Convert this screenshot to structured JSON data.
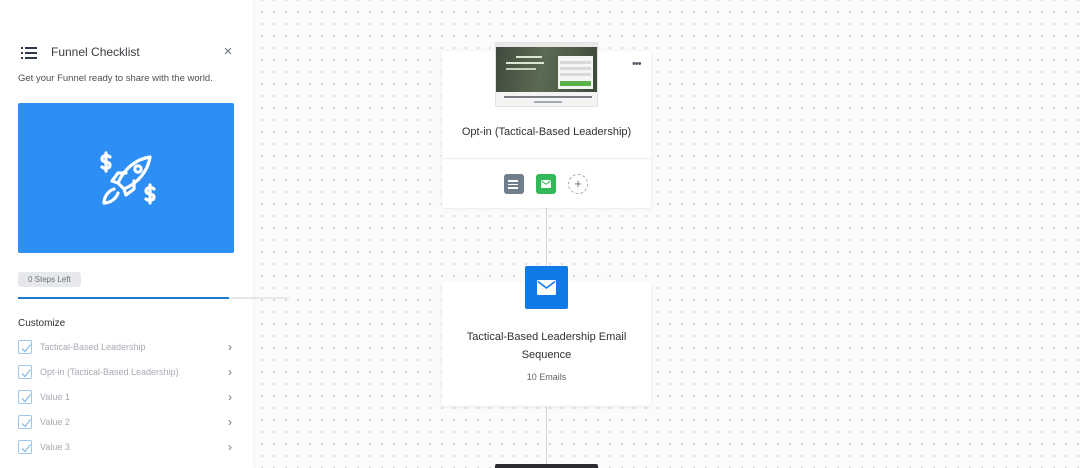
{
  "checklist": {
    "title": "Funnel Checklist",
    "close_symbol": "×",
    "subtitle": "Get your Funnel ready to share with the world.",
    "hero_icon": "rocket-dollar-icon",
    "hero_color": "#2d8ef3",
    "steps_left": "0 Steps Left",
    "progress": 0.78,
    "progress_color": "#1f7ad0",
    "section_title": "Customize",
    "items": [
      {
        "label": "Tactical-Based Leadership",
        "checked": true
      },
      {
        "label": "Opt-in (Tactical-Based Leadership)",
        "checked": true
      },
      {
        "label": "Value 1",
        "checked": true
      },
      {
        "label": "Value 2",
        "checked": true
      },
      {
        "label": "Value 3",
        "checked": true
      }
    ]
  },
  "flow": {
    "optin_card": {
      "title": "Opt-in (Tactical-Based Leadership)",
      "menu_symbol": "•••",
      "add_symbol": "+",
      "actions": [
        "list-icon",
        "mail-icon",
        "add-icon"
      ]
    },
    "email_card": {
      "title": "Tactical-Based Leadership Email Sequence",
      "count": "10 Emails",
      "icon": "mail-icon",
      "icon_color": "#0f79e8"
    }
  }
}
